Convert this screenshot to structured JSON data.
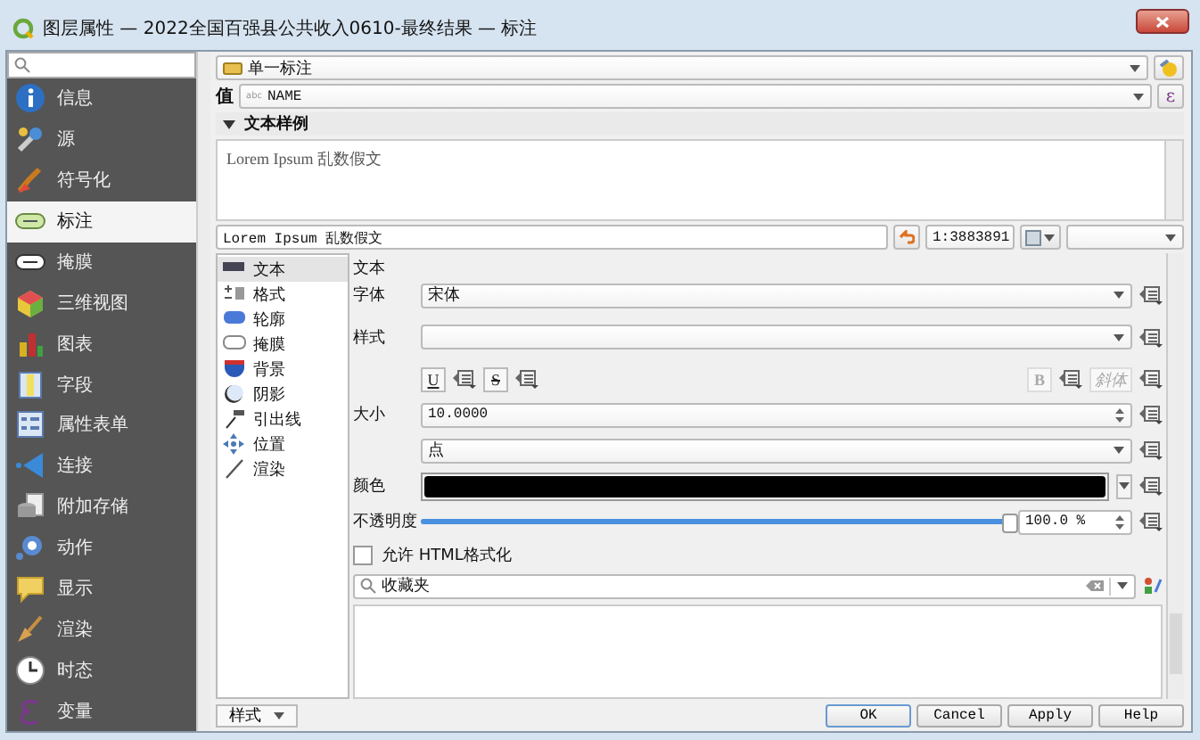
{
  "window": {
    "title": "图层属性 — 2022全国百强县公共收入0610-最终结果 — 标注"
  },
  "sidebar": {
    "items": [
      {
        "label": "信息",
        "selected": false
      },
      {
        "label": "源",
        "selected": false
      },
      {
        "label": "符号化",
        "selected": false
      },
      {
        "label": "标注",
        "selected": true
      },
      {
        "label": "掩膜",
        "selected": false
      },
      {
        "label": "三维视图",
        "selected": false
      },
      {
        "label": "图表",
        "selected": false
      },
      {
        "label": "字段",
        "selected": false
      },
      {
        "label": "属性表单",
        "selected": false
      },
      {
        "label": "连接",
        "selected": false
      },
      {
        "label": "附加存储",
        "selected": false
      },
      {
        "label": "动作",
        "selected": false
      },
      {
        "label": "显示",
        "selected": false
      },
      {
        "label": "渲染",
        "selected": false
      },
      {
        "label": "时态",
        "selected": false
      },
      {
        "label": "变量",
        "selected": false
      }
    ]
  },
  "mode": {
    "value": "单一标注"
  },
  "value_field": {
    "label": "值",
    "type": "abc",
    "value": "NAME",
    "expr": "ε"
  },
  "section": {
    "title": "文本样例",
    "expanded": true
  },
  "preview": {
    "text": "Lorem Ipsum 乱数假文"
  },
  "sample": {
    "text": "Lorem Ipsum 乱数假文",
    "scale": "1:3883891"
  },
  "tabs": [
    {
      "label": "文本",
      "selected": true
    },
    {
      "label": "格式",
      "selected": false
    },
    {
      "label": "轮廓",
      "selected": false
    },
    {
      "label": "掩膜",
      "selected": false
    },
    {
      "label": "背景",
      "selected": false
    },
    {
      "label": "阴影",
      "selected": false
    },
    {
      "label": "引出线",
      "selected": false
    },
    {
      "label": "位置",
      "selected": false
    },
    {
      "label": "渲染",
      "selected": false
    }
  ],
  "text_panel": {
    "title": "文本",
    "font": {
      "label": "字体",
      "value": "宋体"
    },
    "style": {
      "label": "样式"
    },
    "format_buttons": [
      {
        "label": "U",
        "kind": "underline",
        "disabled": false
      },
      {
        "label": "S",
        "kind": "strike",
        "disabled": false
      },
      {
        "label": "B",
        "kind": "bold",
        "disabled": true
      },
      {
        "label": "斜体",
        "kind": "italic",
        "disabled": true
      }
    ],
    "size": {
      "label": "大小",
      "value": "10.0000"
    },
    "unit": {
      "value": "点"
    },
    "color": {
      "label": "颜色"
    },
    "opacity": {
      "label": "不透明度",
      "level": 1,
      "reading": "100.0 %"
    },
    "html": {
      "label": "允许 HTML格式化",
      "checked": false
    },
    "favorites": {
      "value": "收藏夹"
    }
  },
  "footer": {
    "style_button": "样式",
    "buttons": [
      "OK",
      "Cancel",
      "Apply",
      "Help"
    ]
  }
}
